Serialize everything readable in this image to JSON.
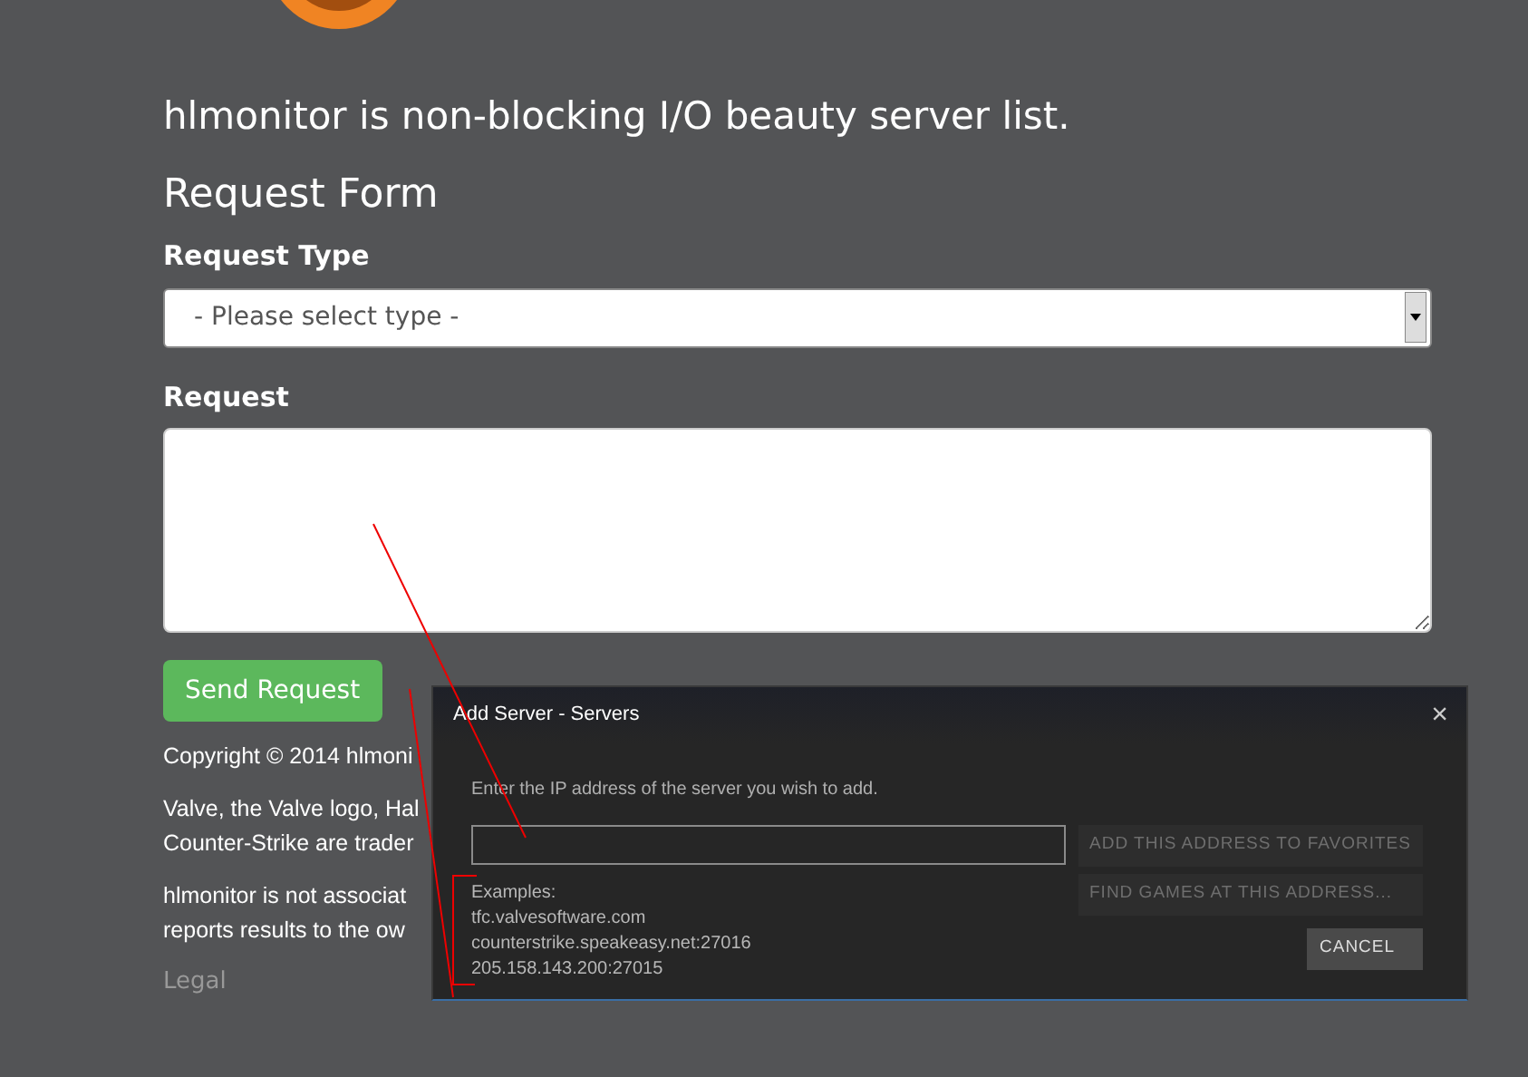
{
  "page": {
    "tagline": "hlmonitor is non-blocking I/O beauty server list.",
    "form_title": "Request Form",
    "type_label": "Request Type",
    "type_select": {
      "value": "- Please select type -"
    },
    "request_label": "Request",
    "send_button": "Send Request",
    "footer": [
      [
        "Copyright © 2014 hlmoni"
      ],
      [
        "Valve, the Valve logo, Hal",
        "Counter-Strike are trader"
      ],
      [
        "hlmonitor is not associat",
        "reports results to the ow"
      ]
    ],
    "legal_link": "Legal"
  },
  "dialog": {
    "title": "Add Server - Servers",
    "close": "×",
    "prompt": "Enter the IP address of the server you wish to add.",
    "examples": [
      "Examples:",
      "tfc.valvesoftware.com",
      "counterstrike.speakeasy.net:27016",
      "205.158.143.200:27015"
    ],
    "buttons": [
      {
        "label": "ADD THIS ADDRESS TO FAVORITES",
        "disabled": true
      },
      {
        "label": "FIND GAMES AT THIS ADDRESS...",
        "disabled": true
      },
      {
        "label": "CANCEL",
        "disabled": false
      }
    ]
  }
}
